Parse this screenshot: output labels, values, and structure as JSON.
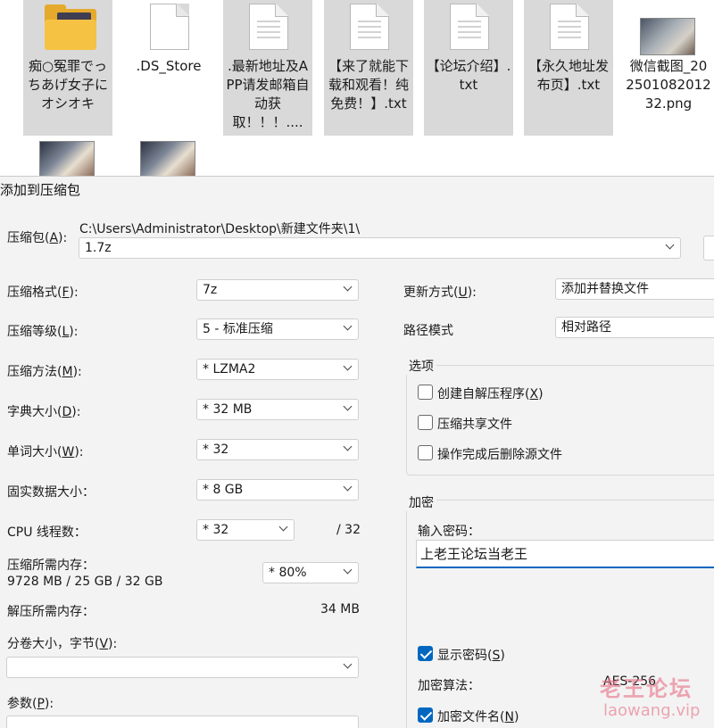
{
  "desktop": {
    "files": [
      {
        "name": "痴○冤罪でっちあげ女子にオシオキ",
        "icon": "folder-icon",
        "selected": true
      },
      {
        "name": ".DS_Store",
        "icon": "file-icon",
        "selected": false
      },
      {
        "name": ".最新地址及APP请发邮箱自动获取！！！....",
        "icon": "text-file-icon",
        "selected": true
      },
      {
        "name": "【来了就能下载和观看！纯免费！】.txt",
        "icon": "text-file-icon",
        "selected": true
      },
      {
        "name": "【论坛介绍】.txt",
        "icon": "text-file-icon",
        "selected": true
      },
      {
        "name": "【永久地址发布页】.txt",
        "icon": "text-file-icon",
        "selected": true
      },
      {
        "name": "微信截图_20250108201232.png",
        "icon": "image-thumbnail",
        "selected": false
      }
    ]
  },
  "dialog": {
    "title": "添加到压缩包",
    "archive": {
      "label": "压缩包(",
      "key": "A",
      "label_end": "):",
      "path": "C:\\Users\\Administrator\\Desktop\\新建文件夹\\1\\",
      "name": "1.7z"
    },
    "format": {
      "label": "压缩格式(",
      "key": "F",
      "label_end": "):",
      "value": "7z"
    },
    "level": {
      "label": "压缩等级(",
      "key": "L",
      "label_end": "):",
      "value": "5 - 标准压缩"
    },
    "method": {
      "label": "压缩方法(",
      "key": "M",
      "label_end": "):",
      "value": "*  LZMA2"
    },
    "dict": {
      "label": "字典大小(",
      "key": "D",
      "label_end": "):",
      "value": "*  32 MB"
    },
    "word": {
      "label": "单词大小(",
      "key": "W",
      "label_end": "):",
      "value": "*  32"
    },
    "solid": {
      "label": "固实数据大小：",
      "value": "*  8 GB"
    },
    "threads": {
      "label": "CPU 线程数：",
      "value": "*  32",
      "max": "/ 32"
    },
    "mem_compress": {
      "label": "压缩所需内存：",
      "value": "9728 MB / 25 GB / 32 GB",
      "percent": "*  80%"
    },
    "mem_decompress": {
      "label": "解压所需内存：",
      "value": "34 MB"
    },
    "volume": {
      "label": "分卷大小，字节(",
      "key": "V",
      "label_end": "):",
      "value": ""
    },
    "params": {
      "label": "参数(",
      "key": "P",
      "label_end": "):"
    },
    "update": {
      "label": "更新方式(",
      "key": "U",
      "label_end": "):",
      "value": "添加并替换文件"
    },
    "path_mode": {
      "label": "路径模式",
      "value": "相对路径"
    },
    "options": {
      "title": "选项",
      "items": [
        {
          "label": "创建自解压程序(",
          "key": "X",
          "label_end": ")",
          "checked": false
        },
        {
          "label": "压缩共享文件",
          "key": "",
          "label_end": "",
          "checked": false
        },
        {
          "label": "操作完成后删除源文件",
          "key": "",
          "label_end": "",
          "checked": false
        }
      ]
    },
    "encryption": {
      "title": "加密",
      "password_label": "输入密码：",
      "password": "上老王论坛当老王",
      "show_password": {
        "label": "显示密码(",
        "key": "S",
        "label_end": ")",
        "checked": true
      },
      "algorithm_label": "加密算法：",
      "algorithm": "AES-256",
      "encrypt_names": {
        "label": "加密文件名(",
        "key": "N",
        "label_end": ")",
        "checked": true
      }
    }
  },
  "watermark": {
    "text": "老王论坛",
    "url": "laowang.vip"
  },
  "colors": {
    "accent": "#0067c0",
    "selection": "#d9d9d9",
    "folder": "#f6c244"
  }
}
